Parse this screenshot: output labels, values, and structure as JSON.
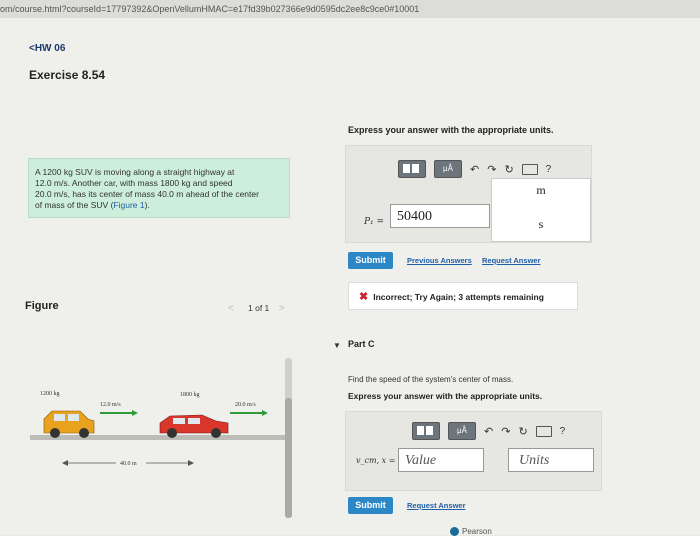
{
  "browser": {
    "url": "om/course.html?courseId=17797392&OpenVellumHMAC=e17fd39b027366e9d0595dc2ee8c9ce0#10001"
  },
  "header": {
    "back_link": "<HW 06",
    "exercise_title": "Exercise 8.54"
  },
  "problem": {
    "line1": "A 1200 kg SUV is moving along a straight highway at",
    "line2": "12.0 m/s. Another car, with mass 1800 kg and speed",
    "line3": "20.0 m/s, has its center of mass 40.0 m ahead of the center",
    "line4_prefix": "of mass of the SUV (",
    "figure_link": "Figure 1",
    "line4_suffix": ")."
  },
  "figure": {
    "label": "Figure",
    "pager_text": "1 of 1",
    "pager_prev": "<",
    "pager_next": ">",
    "suv_mass": "1200 kg",
    "suv_speed": "12.0 m/s",
    "car_mass": "1800 kg",
    "car_speed": "20.0 m/s",
    "distance": "40.0 m",
    "colors": {
      "suv": "#e9a21d",
      "car": "#d9362c",
      "arrow": "#2f9a3a",
      "road": "#bdbdb8"
    }
  },
  "part_b": {
    "express_text": "Express your answer with the appropriate units.",
    "toolbar": {
      "templates_icon": "templates-icon",
      "mu_label": "μÅ",
      "undo_icon": "undo-icon",
      "redo_icon": "redo-icon",
      "reset_icon": "reset-icon",
      "keyboard_icon": "keyboard-icon",
      "help": "?"
    },
    "var_label": "P₁ =",
    "value": "50400",
    "unit_num": "m",
    "unit_den": "s",
    "submit": "Submit",
    "previous_answers": "Previous Answers",
    "request_answer": "Request Answer",
    "feedback_icon": "✖",
    "feedback": "Incorrect; Try Again; 3 attempts remaining"
  },
  "part_c": {
    "title": "Part C",
    "prompt": "Find the speed of the system's center of mass.",
    "express_text": "Express your answer with the appropriate units.",
    "toolbar": {
      "mu_label": "μÅ",
      "help": "?"
    },
    "var_label": "v_cm, x =",
    "value_placeholder": "Value",
    "units_placeholder": "Units",
    "submit": "Submit",
    "request_answer": "Request Answer"
  },
  "footer": {
    "brand": "Pearson"
  }
}
